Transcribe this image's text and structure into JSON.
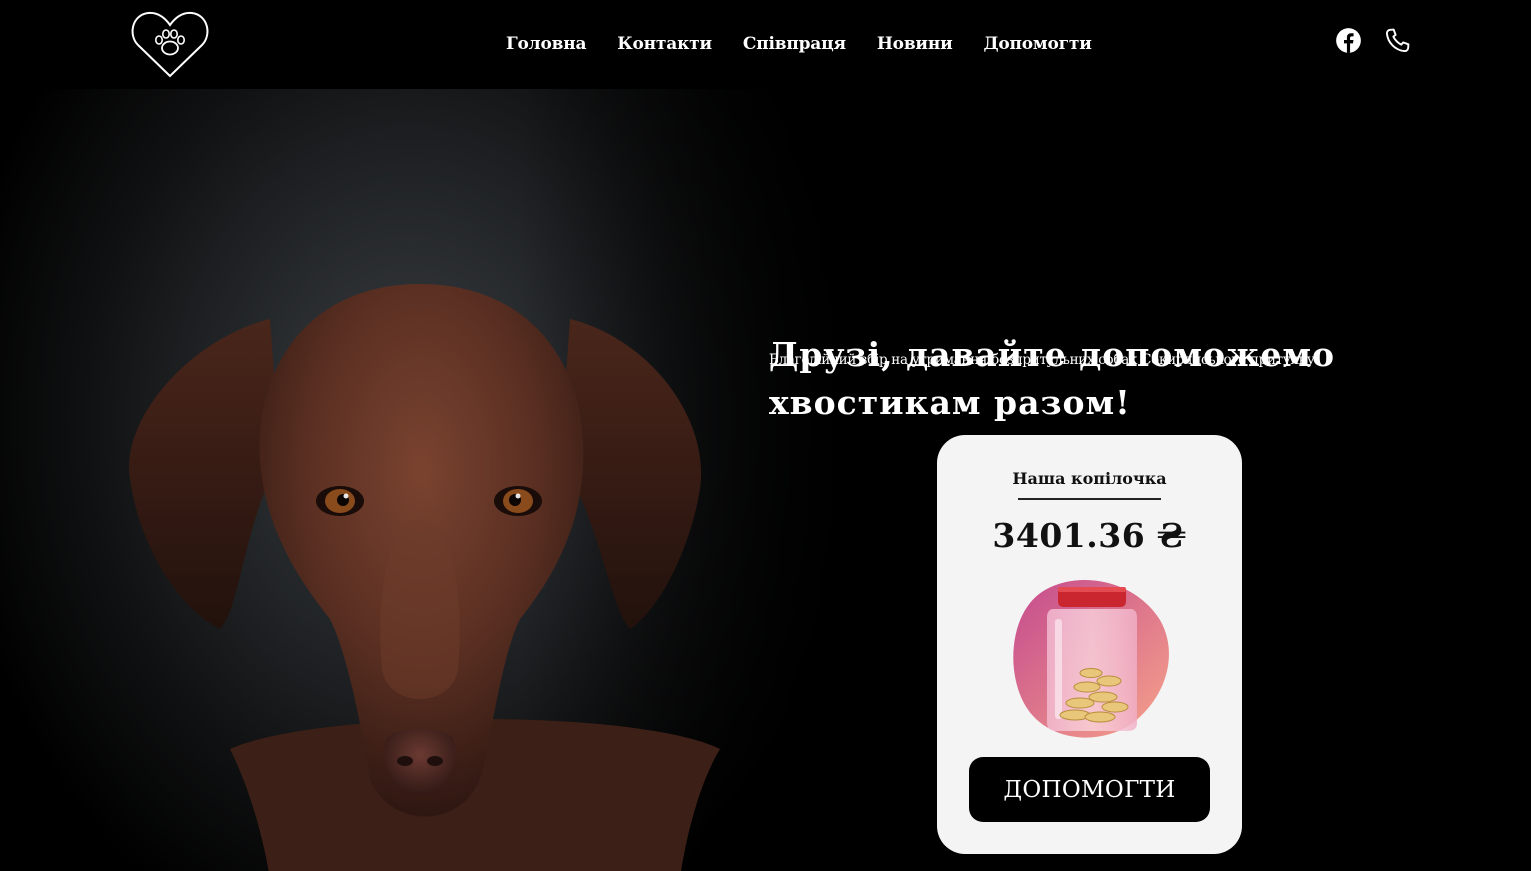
{
  "header": {
    "logo_icon": "heart-paw-icon",
    "nav": [
      {
        "label": "Головна"
      },
      {
        "label": "Контакти"
      },
      {
        "label": "Співпраця"
      },
      {
        "label": "Новини"
      },
      {
        "label": "Допомогти"
      }
    ],
    "social": [
      {
        "icon": "facebook-icon"
      },
      {
        "icon": "phone-icon"
      }
    ]
  },
  "hero": {
    "headline_line1": "Друзі, давайте допоможемо",
    "headline_line2": "хвостикам разом!",
    "subtitle": "Благодійний збір на утримання безпритульних собак Сокирянського притулку.",
    "image": "brown-dog-portrait"
  },
  "donation_card": {
    "title": "Наша копілочка",
    "amount": "3401.36 ₴",
    "illustration": "coin-jar-illustration",
    "button_label": "ДОПОМОГТИ"
  },
  "colors": {
    "background": "#000000",
    "card": "#f4f4f4",
    "button": "#000000",
    "jar_blob_start": "#c9508f",
    "jar_blob_end": "#f49a8a",
    "dog": "#5a2f22"
  }
}
